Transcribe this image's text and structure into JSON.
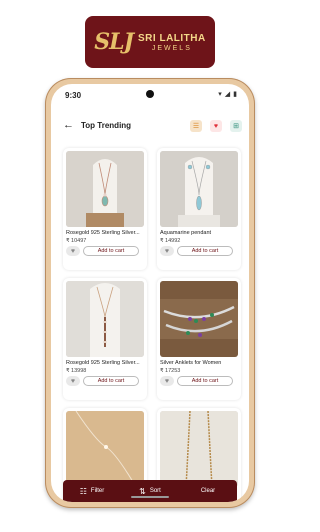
{
  "brand": {
    "monogram": "SLJ",
    "name_line1": "SRI LALITHA",
    "name_line2": "JEWELS",
    "color": "#6e1419"
  },
  "status_bar": {
    "time": "9:30"
  },
  "header": {
    "title": "Top Trending",
    "back_icon": "back-arrow-icon",
    "icons": [
      "list-icon",
      "heart-icon",
      "cart-icon"
    ]
  },
  "products": [
    {
      "name": "Rosegold 925 Sterling Silver...",
      "price": "₹ 10497",
      "add_label": "Add to cart"
    },
    {
      "name": "Aquamarine pendant",
      "price": "₹ 14992",
      "add_label": "Add to cart"
    },
    {
      "name": "Rosegold 925 Sterling Silver...",
      "price": "₹ 13998",
      "add_label": "Add to cart"
    },
    {
      "name": "Silver Anklets for Women",
      "price": "₹ 17253",
      "add_label": "Add to cart"
    },
    {
      "name": "",
      "price": "",
      "add_label": ""
    },
    {
      "name": "",
      "price": "",
      "add_label": ""
    }
  ],
  "bottom_bar": {
    "filter": "Filter",
    "sort": "Sort",
    "clear": "Clear"
  }
}
